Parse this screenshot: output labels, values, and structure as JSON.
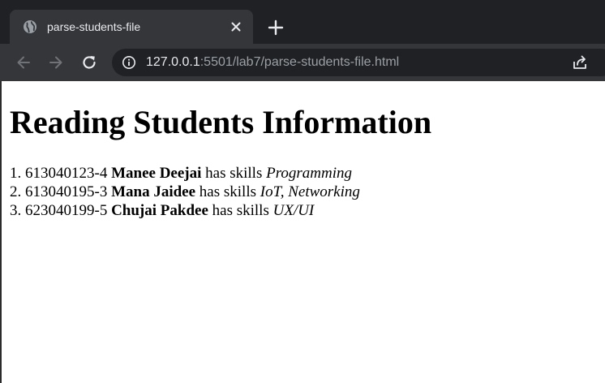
{
  "browser": {
    "tab": {
      "title": "parse-students-file",
      "favicon": "globe-icon",
      "close_icon": "close-icon"
    },
    "new_tab_icon": "plus-icon",
    "nav": {
      "back_icon": "arrow-left-icon",
      "forward_icon": "arrow-right-icon",
      "reload_icon": "reload-icon"
    },
    "address_bar": {
      "info_icon": "info-icon",
      "host": "127.0.0.1",
      "rest": ":5501/lab7/parse-students-file.html",
      "share_icon": "share-icon"
    },
    "colors": {
      "frame": "#202124",
      "toolbar": "#35363a",
      "text": "#e8eaed",
      "muted": "#9aa0a6"
    }
  },
  "page": {
    "title": "Reading Students Information",
    "students": [
      {
        "number": "1.",
        "id": "613040123-4",
        "name": "Manee Deejai",
        "connector": "has skills",
        "skills": "Programming"
      },
      {
        "number": "2.",
        "id": "613040195-3",
        "name": "Mana Jaidee",
        "connector": "has skills",
        "skills": "IoT, Networking"
      },
      {
        "number": "3.",
        "id": "623040199-5",
        "name": "Chujai Pakdee",
        "connector": "has skills",
        "skills": "UX/UI"
      }
    ]
  }
}
